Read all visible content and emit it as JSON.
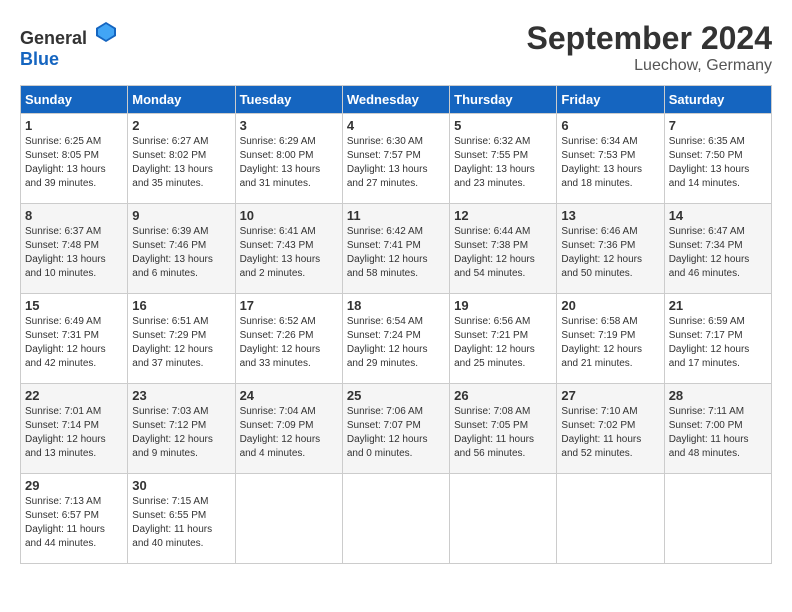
{
  "header": {
    "logo_general": "General",
    "logo_blue": "Blue",
    "month_year": "September 2024",
    "location": "Luechow, Germany"
  },
  "weekdays": [
    "Sunday",
    "Monday",
    "Tuesday",
    "Wednesday",
    "Thursday",
    "Friday",
    "Saturday"
  ],
  "weeks": [
    [
      {
        "day": "1",
        "sunrise": "6:25 AM",
        "sunset": "8:05 PM",
        "daylight": "13 hours and 39 minutes."
      },
      {
        "day": "2",
        "sunrise": "6:27 AM",
        "sunset": "8:02 PM",
        "daylight": "13 hours and 35 minutes."
      },
      {
        "day": "3",
        "sunrise": "6:29 AM",
        "sunset": "8:00 PM",
        "daylight": "13 hours and 31 minutes."
      },
      {
        "day": "4",
        "sunrise": "6:30 AM",
        "sunset": "7:57 PM",
        "daylight": "13 hours and 27 minutes."
      },
      {
        "day": "5",
        "sunrise": "6:32 AM",
        "sunset": "7:55 PM",
        "daylight": "13 hours and 23 minutes."
      },
      {
        "day": "6",
        "sunrise": "6:34 AM",
        "sunset": "7:53 PM",
        "daylight": "13 hours and 18 minutes."
      },
      {
        "day": "7",
        "sunrise": "6:35 AM",
        "sunset": "7:50 PM",
        "daylight": "13 hours and 14 minutes."
      }
    ],
    [
      {
        "day": "8",
        "sunrise": "6:37 AM",
        "sunset": "7:48 PM",
        "daylight": "13 hours and 10 minutes."
      },
      {
        "day": "9",
        "sunrise": "6:39 AM",
        "sunset": "7:46 PM",
        "daylight": "13 hours and 6 minutes."
      },
      {
        "day": "10",
        "sunrise": "6:41 AM",
        "sunset": "7:43 PM",
        "daylight": "13 hours and 2 minutes."
      },
      {
        "day": "11",
        "sunrise": "6:42 AM",
        "sunset": "7:41 PM",
        "daylight": "12 hours and 58 minutes."
      },
      {
        "day": "12",
        "sunrise": "6:44 AM",
        "sunset": "7:38 PM",
        "daylight": "12 hours and 54 minutes."
      },
      {
        "day": "13",
        "sunrise": "6:46 AM",
        "sunset": "7:36 PM",
        "daylight": "12 hours and 50 minutes."
      },
      {
        "day": "14",
        "sunrise": "6:47 AM",
        "sunset": "7:34 PM",
        "daylight": "12 hours and 46 minutes."
      }
    ],
    [
      {
        "day": "15",
        "sunrise": "6:49 AM",
        "sunset": "7:31 PM",
        "daylight": "12 hours and 42 minutes."
      },
      {
        "day": "16",
        "sunrise": "6:51 AM",
        "sunset": "7:29 PM",
        "daylight": "12 hours and 37 minutes."
      },
      {
        "day": "17",
        "sunrise": "6:52 AM",
        "sunset": "7:26 PM",
        "daylight": "12 hours and 33 minutes."
      },
      {
        "day": "18",
        "sunrise": "6:54 AM",
        "sunset": "7:24 PM",
        "daylight": "12 hours and 29 minutes."
      },
      {
        "day": "19",
        "sunrise": "6:56 AM",
        "sunset": "7:21 PM",
        "daylight": "12 hours and 25 minutes."
      },
      {
        "day": "20",
        "sunrise": "6:58 AM",
        "sunset": "7:19 PM",
        "daylight": "12 hours and 21 minutes."
      },
      {
        "day": "21",
        "sunrise": "6:59 AM",
        "sunset": "7:17 PM",
        "daylight": "12 hours and 17 minutes."
      }
    ],
    [
      {
        "day": "22",
        "sunrise": "7:01 AM",
        "sunset": "7:14 PM",
        "daylight": "12 hours and 13 minutes."
      },
      {
        "day": "23",
        "sunrise": "7:03 AM",
        "sunset": "7:12 PM",
        "daylight": "12 hours and 9 minutes."
      },
      {
        "day": "24",
        "sunrise": "7:04 AM",
        "sunset": "7:09 PM",
        "daylight": "12 hours and 4 minutes."
      },
      {
        "day": "25",
        "sunrise": "7:06 AM",
        "sunset": "7:07 PM",
        "daylight": "12 hours and 0 minutes."
      },
      {
        "day": "26",
        "sunrise": "7:08 AM",
        "sunset": "7:05 PM",
        "daylight": "11 hours and 56 minutes."
      },
      {
        "day": "27",
        "sunrise": "7:10 AM",
        "sunset": "7:02 PM",
        "daylight": "11 hours and 52 minutes."
      },
      {
        "day": "28",
        "sunrise": "7:11 AM",
        "sunset": "7:00 PM",
        "daylight": "11 hours and 48 minutes."
      }
    ],
    [
      {
        "day": "29",
        "sunrise": "7:13 AM",
        "sunset": "6:57 PM",
        "daylight": "11 hours and 44 minutes."
      },
      {
        "day": "30",
        "sunrise": "7:15 AM",
        "sunset": "6:55 PM",
        "daylight": "11 hours and 40 minutes."
      },
      null,
      null,
      null,
      null,
      null
    ]
  ]
}
